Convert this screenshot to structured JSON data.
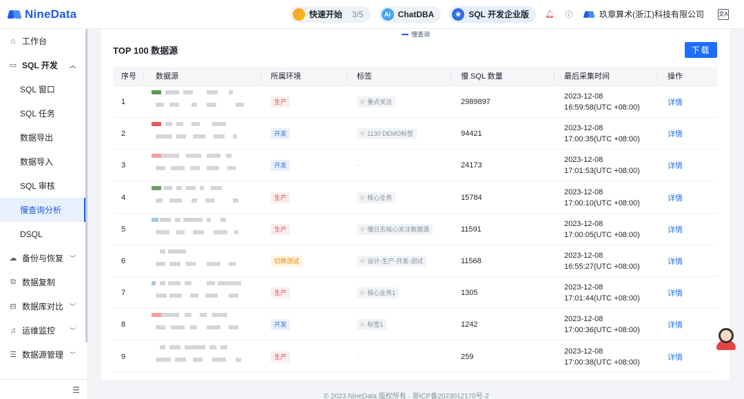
{
  "app": {
    "logo_text": "NineData",
    "brand_color": "#1e5ce6"
  },
  "topbar": {
    "quick_start_label": "快速开始",
    "quick_start_progress": "3/5",
    "chatdba_badge": "AI",
    "chatdba_label": "ChatDBA",
    "sql_edition_label": "SQL 开发企业版",
    "company": "玖章算术(浙江)科技有限公司",
    "lang_icon_text": "文A"
  },
  "sidebar": {
    "items": [
      {
        "label": "工作台",
        "icon": "home-icon"
      },
      {
        "label": "SQL 开发",
        "icon": "monitor-icon",
        "expanded": true
      },
      {
        "label": "SQL 窗口"
      },
      {
        "label": "SQL 任务"
      },
      {
        "label": "数据导出"
      },
      {
        "label": "数据导入"
      },
      {
        "label": "SQL 审核"
      },
      {
        "label": "慢查询分析",
        "active": true
      },
      {
        "label": "DSQL"
      },
      {
        "label": "备份与恢复",
        "icon": "cloud-icon"
      },
      {
        "label": "数据复制",
        "icon": "copy-icon"
      },
      {
        "label": "数据库对比",
        "icon": "compare-icon"
      },
      {
        "label": "运维监控",
        "icon": "bell-icon"
      },
      {
        "label": "数据源管理",
        "icon": "database-icon"
      }
    ]
  },
  "main": {
    "legend_hint": "慢查询",
    "title": "TOP 100 数据源",
    "download_label": "下载",
    "columns": [
      "序号",
      "数据源",
      "所属环境",
      "标签",
      "慢 SQL 数量",
      "最后采集时间",
      "操作"
    ],
    "rows": [
      {
        "no": "1",
        "env": "生产",
        "env_type": "prod",
        "tag": "重点关注",
        "count": "2989897",
        "date": "2023-12-08",
        "time": "16:59:58(UTC +08:00)",
        "action": "详情"
      },
      {
        "no": "2",
        "env": "开发",
        "env_type": "dev",
        "tag": "1130 DEMO标签",
        "count": "94421",
        "date": "2023-12-08",
        "time": "17:00:35(UTC +08:00)",
        "action": "详情"
      },
      {
        "no": "3",
        "env": "开发",
        "env_type": "dev",
        "tag": "-",
        "count": "24173",
        "date": "2023-12-08",
        "time": "17:01:53(UTC +08:00)",
        "action": "详情"
      },
      {
        "no": "4",
        "env": "生产",
        "env_type": "prod",
        "tag": "核心业务",
        "count": "15784",
        "date": "2023-12-08",
        "time": "17:00:10(UTC +08:00)",
        "action": "详情"
      },
      {
        "no": "5",
        "env": "生产",
        "env_type": "prod",
        "tag": "慢日志核心关注数据源",
        "count": "11591",
        "date": "2023-12-08",
        "time": "17:00:05(UTC +08:00)",
        "action": "详情"
      },
      {
        "no": "6",
        "env": "切换测试",
        "env_type": "switch",
        "tag": "设计-生产-开发-测试",
        "count": "11568",
        "date": "2023-12-08",
        "time": "16:55:27(UTC +08:00)",
        "action": "详情"
      },
      {
        "no": "7",
        "env": "生产",
        "env_type": "prod",
        "tag": "核心业务1",
        "count": "1305",
        "date": "2023-12-08",
        "time": "17:01:44(UTC +08:00)",
        "action": "详情"
      },
      {
        "no": "8",
        "env": "开发",
        "env_type": "dev",
        "tag": "标签1",
        "count": "1242",
        "date": "2023-12-08",
        "time": "17:00:36(UTC +08:00)",
        "action": "详情"
      },
      {
        "no": "9",
        "env": "生产",
        "env_type": "prod",
        "tag": "-",
        "count": "259",
        "date": "2023-12-08",
        "time": "17:00:38(UTC +08:00)",
        "action": "详情"
      }
    ]
  },
  "footer": {
    "text": "© 2023 NineData 版权所有 · 浙ICP备2023012170号-2"
  }
}
